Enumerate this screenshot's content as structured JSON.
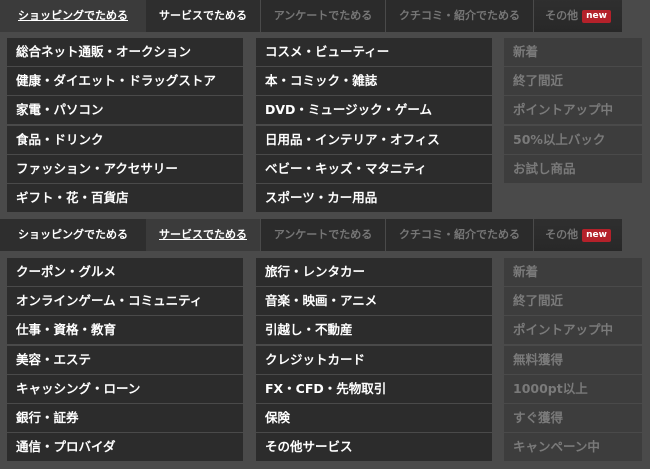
{
  "panel1": {
    "tabs": [
      {
        "label": "ショッピングでためる"
      },
      {
        "label": "サービスでためる"
      },
      {
        "label": "アンケートでためる"
      },
      {
        "label": "クチコミ・紹介でためる"
      },
      {
        "label": "その他",
        "badge": "new"
      }
    ],
    "col1": [
      "総合ネット通販・オークション",
      "健康・ダイエット・ドラッグストア",
      "家電・パソコン",
      "食品・ドリンク",
      "ファッション・アクセサリー",
      "ギフト・花・百貨店"
    ],
    "col2": [
      "コスメ・ビューティー",
      "本・コミック・雑誌",
      "DVD・ミュージック・ゲーム",
      "日用品・インテリア・オフィス",
      "ベビー・キッズ・マタニティ",
      "スポーツ・カー用品"
    ],
    "col3": [
      "新着",
      "終了間近",
      "ポイントアップ中",
      "50%以上バック",
      "お試し商品"
    ]
  },
  "panel2": {
    "tabs": [
      {
        "label": "ショッピングでためる"
      },
      {
        "label": "サービスでためる"
      },
      {
        "label": "アンケートでためる"
      },
      {
        "label": "クチコミ・紹介でためる"
      },
      {
        "label": "その他",
        "badge": "new"
      }
    ],
    "col1": [
      "クーポン・グルメ",
      "オンラインゲーム・コミュニティ",
      "仕事・資格・教育",
      "美容・エステ",
      "キャッシング・ローン",
      "銀行・証券",
      "通信・プロバイダ"
    ],
    "col2": [
      "旅行・レンタカー",
      "音楽・映画・アニメ",
      "引越し・不動産",
      "クレジットカード",
      "FX・CFD・先物取引",
      "保険",
      "その他サービス"
    ],
    "col3": [
      "新着",
      "終了間近",
      "ポイントアップ中",
      "無料獲得",
      "1000pt以上",
      "すぐ獲得",
      "キャンペーン中"
    ]
  },
  "colors": {
    "page_bg": "#4a4a4a",
    "dark_cell": "#2c2c2c",
    "light_cell": "#3d3d3d",
    "badge": "#b4212a"
  }
}
